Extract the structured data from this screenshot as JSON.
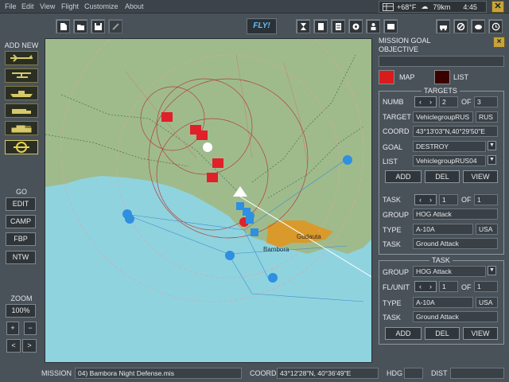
{
  "menu": [
    "File",
    "Edit",
    "View",
    "Flight",
    "Customize",
    "About"
  ],
  "weather": {
    "temp": "+68°F",
    "wind": "79km",
    "time": "4:45"
  },
  "toolbar": {
    "fly_label": "FLY!"
  },
  "left": {
    "add_new": "ADD NEW",
    "go": "GO",
    "go_buttons": [
      "EDIT",
      "CAMP",
      "FBP",
      "NTW"
    ],
    "zoom_label": "ZOOM",
    "zoom_value": "100%",
    "plus": "+",
    "minus": "−",
    "left_arrow": "<",
    "right_arrow": ">"
  },
  "map_labels": {
    "city1": "Gudauta",
    "city2": "Bambora"
  },
  "right": {
    "mission_goal": "MISSION GOAL",
    "objective": "OBJECTIVE",
    "close": "×",
    "map_label": "MAP",
    "list_label": "LIST",
    "targets": {
      "legend": "TARGETS",
      "numb_label": "NUMB",
      "numb_value": "2",
      "of_label": "OF",
      "of_value": "3",
      "target_label": "TARGET",
      "target_value": "VehiclegroupRUS",
      "target_country": "RUS",
      "coord_label": "COORD",
      "coord_value": "43°13'03\"N,40°29'50\"E",
      "goal_label": "GOAL",
      "goal_value": "DESTROY",
      "list_label": "LIST",
      "list_value": "VehiclegroupRUS04",
      "add": "ADD",
      "del": "DEL",
      "view": "VIEW",
      "task_label": "TASK",
      "task_value": "1",
      "task_of_label": "OF",
      "task_of_value": "1",
      "group_label": "GROUP",
      "group_value": "HOG Attack",
      "type_label": "TYPE",
      "type_value": "A-10A",
      "type_country": "USA",
      "task2_label": "TASK",
      "task2_value": "Ground Attack"
    },
    "task": {
      "legend": "TASK",
      "group_label": "GROUP",
      "group_value": "HOG Attack",
      "flunit_label": "FL/UNIT",
      "flunit_value": "1",
      "of_label": "OF",
      "of_value": "1",
      "type_label": "TYPE",
      "type_value": "A-10A",
      "type_country": "USA",
      "task_label": "TASK",
      "task_value": "Ground Attack",
      "add": "ADD",
      "del": "DEL",
      "view": "VIEW"
    }
  },
  "status": {
    "mission_label": "MISSION",
    "mission_value": "04) Bambora Night Defense.mis",
    "coord_label": "COORD",
    "coord_value": "43°12'28\"N, 40°36'49\"E",
    "hdg_label": "HDG",
    "hdg_value": "",
    "dist_label": "DIST",
    "dist_value": ""
  },
  "colors": {
    "sea": "#8fd3df",
    "land": "#9fbb8c",
    "city": "#d99a2b",
    "red_unit": "#e0202a",
    "blue_unit": "#2f8fe0"
  }
}
